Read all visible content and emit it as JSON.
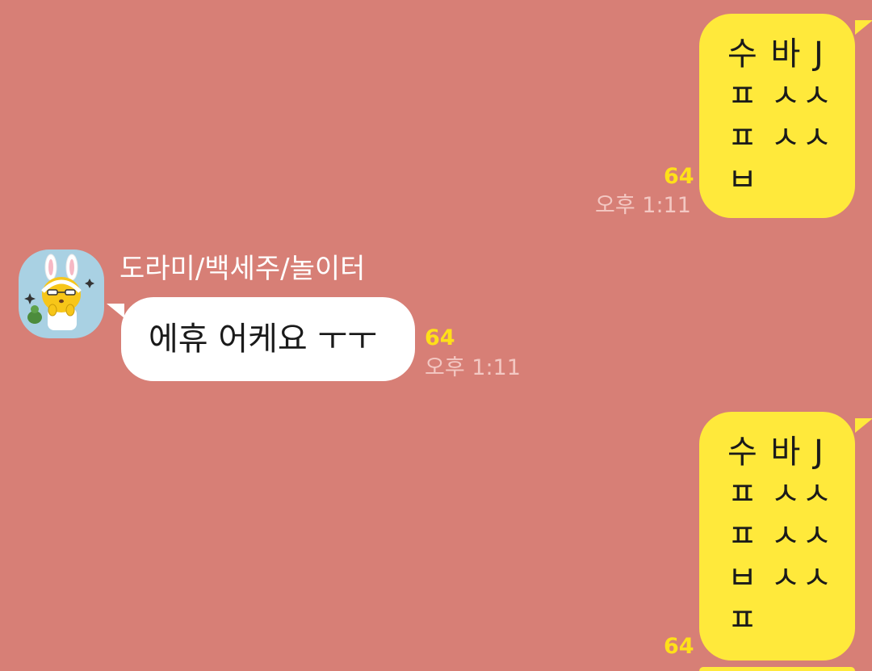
{
  "messages": [
    {
      "direction": "outgoing",
      "text": "수 바 J\nㅍ ㅅㅅ\nㅍ ㅅㅅ\nㅂ",
      "unread_count": "64",
      "time": "오후 1:11"
    },
    {
      "direction": "incoming",
      "sender": "도라미/백세주/놀이터",
      "text": "에휴 어케요 ㅜㅜ",
      "unread_count": "64",
      "time": "오후 1:11"
    },
    {
      "direction": "outgoing",
      "text": "수 바 J\nㅍ ㅅㅅ\nㅍ ㅅㅅ\nㅂ ㅅㅅ\nㅍ",
      "unread_count": "64"
    }
  ],
  "colors": {
    "background": "#d77f76",
    "outgoing_bubble": "#ffe93b",
    "incoming_bubble": "#ffffff",
    "unread": "#ffe019",
    "time": "#f3c8c3"
  },
  "avatar_icon": "rabbit-character-icon"
}
